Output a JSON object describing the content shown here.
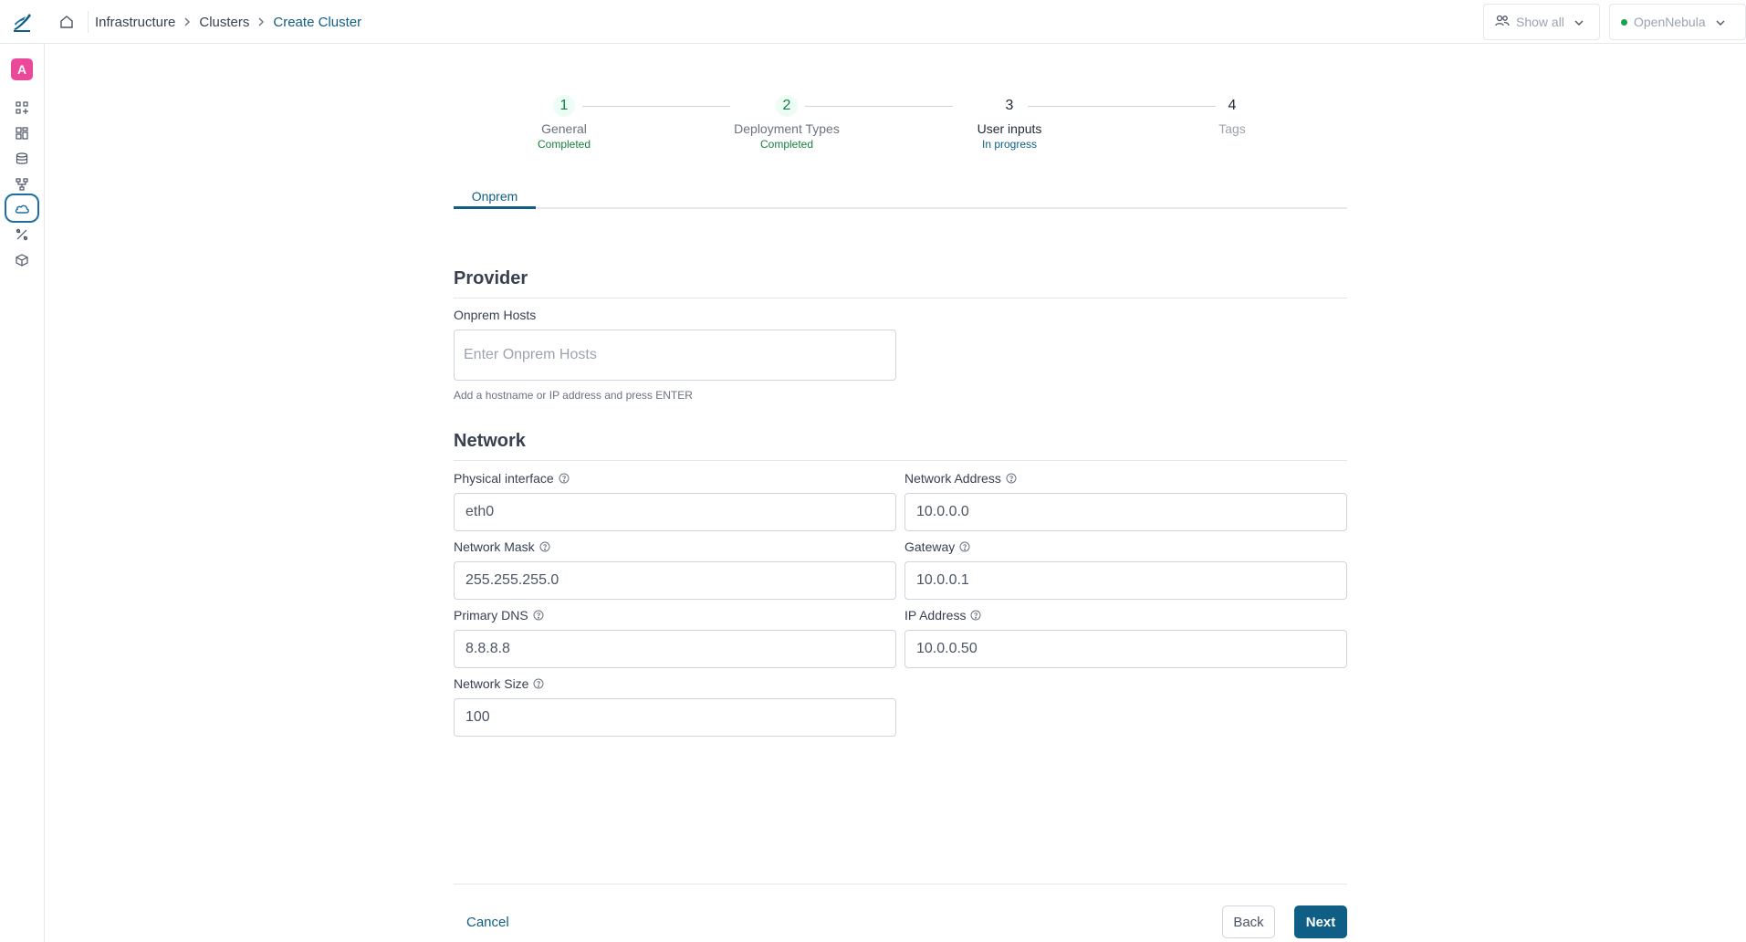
{
  "breadcrumb": {
    "items": [
      "Infrastructure",
      "Clusters",
      "Create Cluster"
    ]
  },
  "top_right": {
    "group_filter": "Show all",
    "cloud": "OpenNebula"
  },
  "sidebar": {
    "avatar_letter": "A",
    "items": [
      "apps-icon",
      "dashboard-icon",
      "storage-icon",
      "network-icon",
      "cloud-icon",
      "tools-icon",
      "cube-icon"
    ],
    "active": "cloud-icon"
  },
  "stepper": {
    "steps": [
      {
        "number": "1",
        "title": "General",
        "status": "Completed"
      },
      {
        "number": "2",
        "title": "Deployment Types",
        "status": "Completed"
      },
      {
        "number": "3",
        "title": "User inputs",
        "status": "In progress"
      },
      {
        "number": "4",
        "title": "Tags",
        "status": ""
      }
    ]
  },
  "tabs": {
    "active": "Onprem"
  },
  "provider": {
    "title": "Provider",
    "hosts_label": "Onprem Hosts",
    "hosts_placeholder": "Enter Onprem Hosts",
    "hosts_helper": "Add a hostname or IP address and press ENTER"
  },
  "network": {
    "title": "Network",
    "fields": {
      "physical_interface": {
        "label": "Physical interface",
        "value": "eth0"
      },
      "network_address": {
        "label": "Network Address",
        "value": "10.0.0.0"
      },
      "network_mask": {
        "label": "Network Mask",
        "value": "255.255.255.0"
      },
      "gateway": {
        "label": "Gateway",
        "value": "10.0.0.1"
      },
      "primary_dns": {
        "label": "Primary DNS",
        "value": "8.8.8.8"
      },
      "ip_address": {
        "label": "IP Address",
        "value": "10.0.0.50"
      },
      "network_size": {
        "label": "Network Size",
        "value": "100"
      }
    }
  },
  "footer": {
    "cancel": "Cancel",
    "back": "Back",
    "next": "Next"
  },
  "colors": {
    "primary": "#0e5e86",
    "success": "#15803d",
    "avatar": "#ec4899"
  }
}
